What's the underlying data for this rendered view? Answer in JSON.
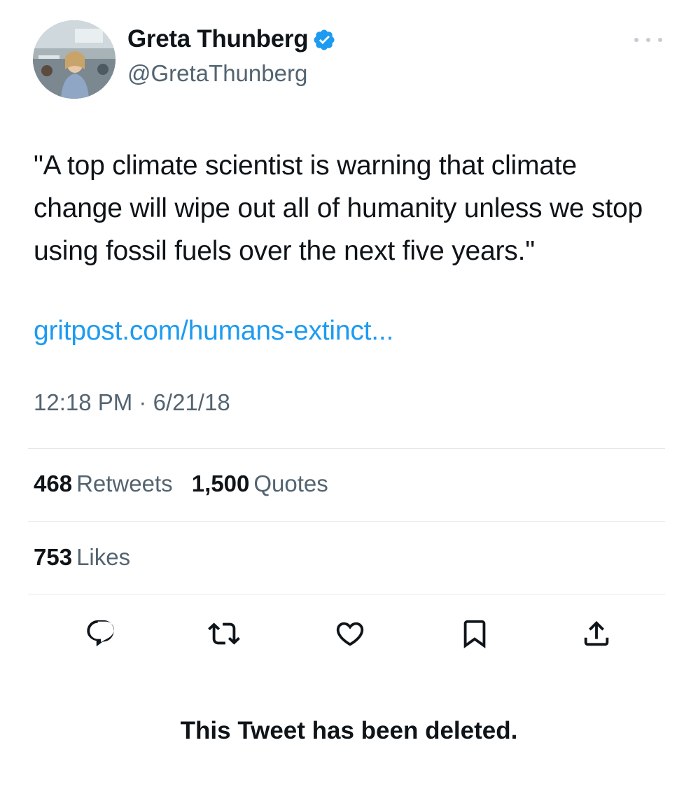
{
  "author": {
    "display_name": "Greta Thunberg",
    "handle": "@GretaThunberg",
    "verified": true
  },
  "tweet": {
    "text": "\"A top climate scientist is warning that climate change will wipe out all of humanity unless we stop using fossil fuels over the next five years.\"",
    "link": "gritpost.com/humans-extinct...",
    "timestamp": "12:18 PM · 6/21/18"
  },
  "stats": {
    "retweets_count": "468",
    "retweets_label": "Retweets",
    "quotes_count": "1,500",
    "quotes_label": "Quotes",
    "likes_count": "753",
    "likes_label": "Likes"
  },
  "actions": [
    "reply-icon",
    "retweet-icon",
    "like-icon",
    "bookmark-icon",
    "share-icon"
  ],
  "footer": {
    "deleted_message": "This Tweet has been deleted."
  },
  "colors": {
    "text": "#0f1419",
    "secondary": "#536471",
    "link": "#1d9bf0",
    "verified": "#1d9bf0",
    "divider": "#e3e8eb"
  }
}
